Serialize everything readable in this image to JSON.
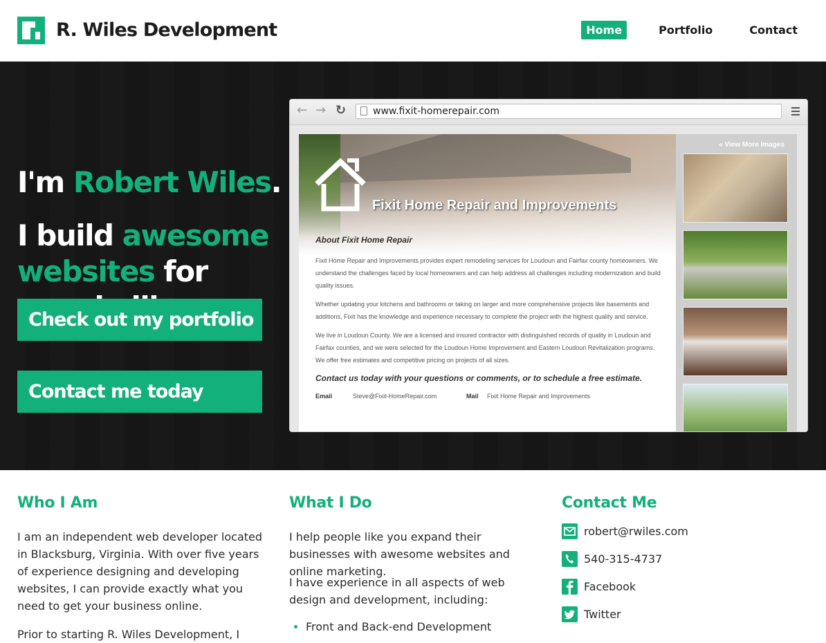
{
  "header": {
    "brand": "R. Wiles Development",
    "nav": [
      {
        "label": "Home",
        "active": true
      },
      {
        "label": "Portfolio",
        "active": false
      },
      {
        "label": "Contact",
        "active": false
      }
    ]
  },
  "hero": {
    "intro_prefix": "I'm ",
    "intro_name": "Robert Wiles",
    "intro_suffix": ".",
    "tagline_1": "I build ",
    "tagline_highlight": "awesome websites",
    "tagline_2": " for people like you.",
    "cta_portfolio": "Check out my portfolio",
    "cta_contact": "Contact me today"
  },
  "browser_mock": {
    "url": "www.fixit-homerepair.com",
    "site": {
      "view_more": "« View More Images",
      "title": "Fixit Home Repair and Improvements",
      "about_heading": "About Fixit Home Repair",
      "p1": "Fixit Home Repair and Improvements provides expert remodeling services for Loudoun and Fairfax county homeowners. We understand the challenges faced by local homeowners and can help address all challenges including modernization and build quality issues.",
      "p2": "Whether updating your kitchens and bathrooms or taking on larger and more comprehensive projects like basements and additions, Fixit has the knowledge and experience necessary to complete the project with the highest quality and service.",
      "p3": "We live in Loudoun County. We are a licensed and insured contractor with distinguished records of quality in Loudoun and Fairfax counties, and we were selected for the Loudoun Home Improvement and Eastern Loudoun Revitalization programs. We offer free estimates and competitive pricing on projects of all sizes.",
      "contact_line": "Contact us today with your questions or comments, or to schedule a free estimate.",
      "email_label": "Email",
      "email_value": "Steve@Fixit-HomeRepair.com",
      "mail_label": "Mail",
      "mail_value": "Fixit Home Repair and Improvements"
    }
  },
  "who": {
    "heading": "Who I Am",
    "p1": "I am an independent web developer located in Blacksburg, Virginia. With over five years of experience designing and developing websites, I can provide exactly what you need to get your business online.",
    "p2": "Prior to starting R. Wiles Development, I"
  },
  "what": {
    "heading": "What I Do",
    "p1": "I help people like you expand their businesses with awesome websites and online marketing.",
    "p2": "I have experience in all aspects of web design and development, including:",
    "list": [
      "Front and Back-end Development"
    ]
  },
  "contact": {
    "heading": "Contact Me",
    "items": [
      {
        "icon": "email-icon",
        "label": "robert@rwiles.com"
      },
      {
        "icon": "phone-icon",
        "label": "540-315-4737"
      },
      {
        "icon": "facebook-icon",
        "label": "Facebook"
      },
      {
        "icon": "twitter-icon",
        "label": "Twitter"
      }
    ]
  },
  "colors": {
    "accent": "#13b07c",
    "hero_bg": "#161616"
  }
}
